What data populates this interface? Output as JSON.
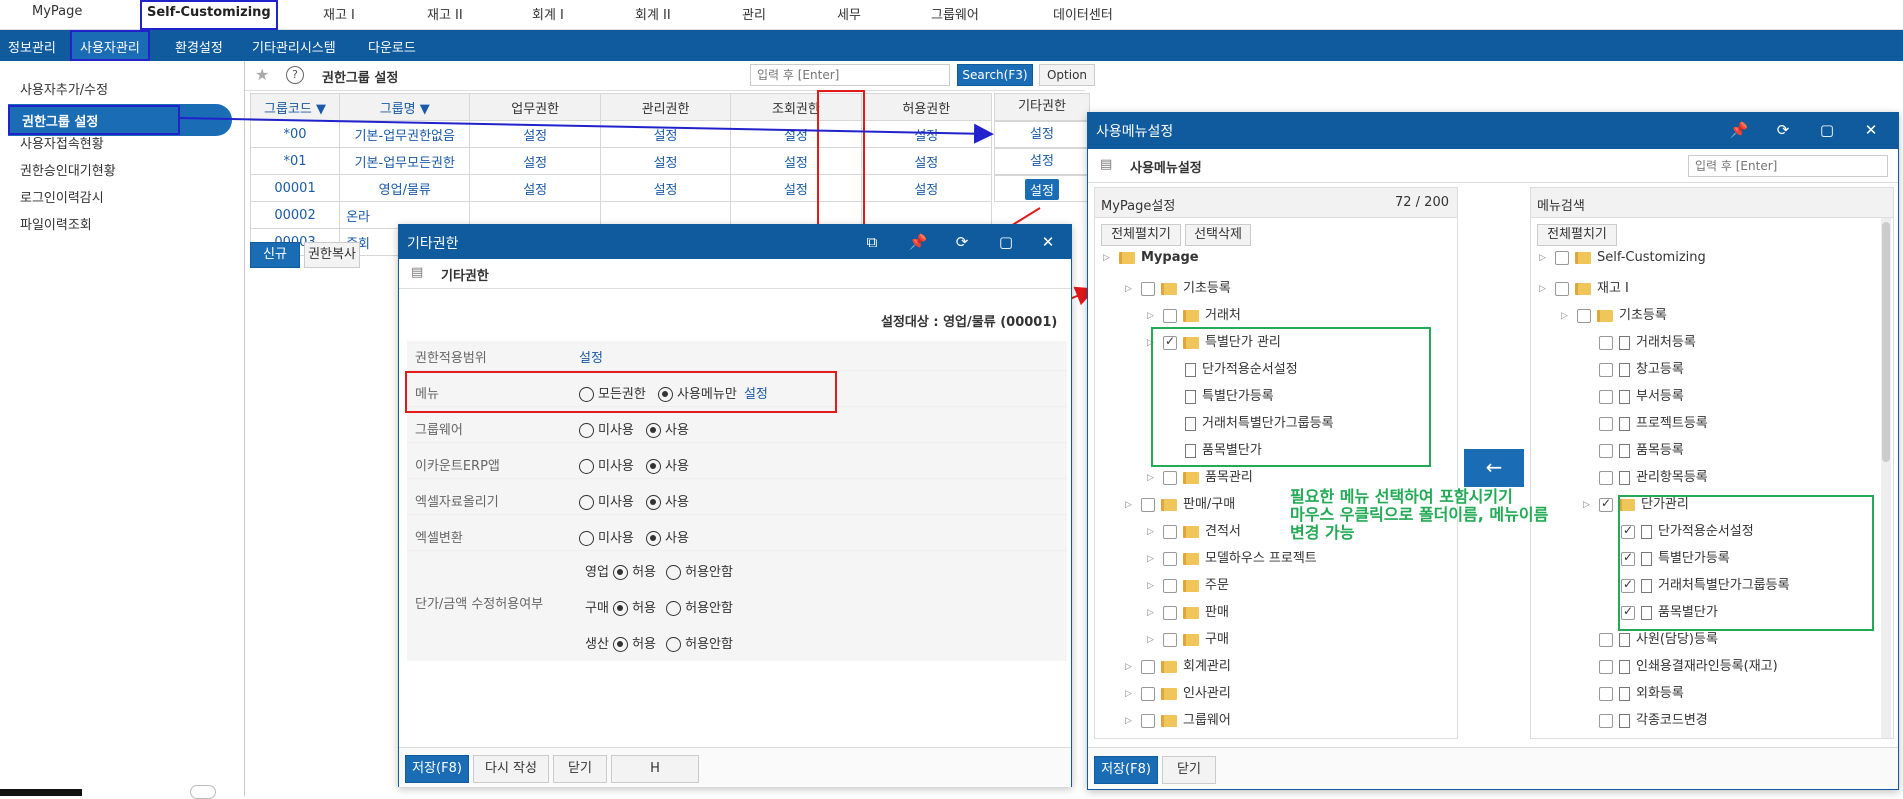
{
  "top_menu": [
    "MyPage",
    "Self-Customizing",
    "재고 I",
    "재고 II",
    "회계 I",
    "회계 II",
    "관리",
    "세무",
    "그룹웨어",
    "데이터센터"
  ],
  "sub_nav": [
    "정보관리",
    "사용자관리",
    "환경설정",
    "기타관리시스템",
    "다운로드"
  ],
  "sidebar": [
    "사용자추가/수정",
    "권한그룹 설정",
    "사용자접속현황",
    "권한승인대기현황",
    "로그인이력감시",
    "파일이력조회"
  ],
  "page": {
    "title": "권한그룹 설정",
    "search_placeholder": "입력 후 [Enter]",
    "search_btn": "Search(F3)",
    "option_btn": "Option",
    "new_btn": "신규(F2)",
    "copy_btn": "권한복사"
  },
  "grid": {
    "headers": [
      "그룹코드 ▼",
      "그룹명 ▼",
      "업무권한",
      "관리권한",
      "조회권한",
      "허용권한",
      "기타권한"
    ],
    "rows": [
      {
        "code": "*00",
        "name": "기본-업무권한없음",
        "cells": [
          "설정",
          "설정",
          "설정",
          "설정",
          "설정"
        ]
      },
      {
        "code": "*01",
        "name": "기본-업무모든권한",
        "cells": [
          "설정",
          "설정",
          "설정",
          "설정",
          "설정"
        ]
      },
      {
        "code": "00001",
        "name": "영업/물류",
        "cells": [
          "설정",
          "설정",
          "설정",
          "설정",
          "설정"
        ]
      },
      {
        "code": "00002",
        "name": "온라",
        "cells": []
      },
      {
        "code": "00003",
        "name": "중회",
        "cells": []
      }
    ]
  },
  "dlg1": {
    "title": "기타권한",
    "subtitle": "기타권한",
    "target": "설정대상 : 영업/물류 (00001)",
    "rows": [
      {
        "label": "권한적용범위",
        "value": "설정"
      },
      {
        "label": "메뉴",
        "opt1": "모든권한",
        "opt2": "사용메뉴만",
        "link": "설정"
      },
      {
        "label": "그룹웨어",
        "opt1": "미사용",
        "opt2": "사용"
      },
      {
        "label": "이카운트ERP앱",
        "opt1": "미사용",
        "opt2": "사용"
      },
      {
        "label": "엑셀자료올리기",
        "opt1": "미사용",
        "opt2": "사용"
      },
      {
        "label": "엑셀변환",
        "opt1": "미사용",
        "opt2": "사용"
      }
    ],
    "price_label": "단가/금액 수정허용여부",
    "price_rows": [
      {
        "k": "영업",
        "a": "허용",
        "b": "허용안함"
      },
      {
        "k": "구매",
        "a": "허용",
        "b": "허용안함"
      },
      {
        "k": "생산",
        "a": "허용",
        "b": "허용안함"
      }
    ],
    "buttons": [
      "저장(F8)",
      "다시 작성",
      "닫기",
      "H"
    ]
  },
  "dlg2": {
    "title": "사용메뉴설정",
    "subtitle": "사용메뉴설정",
    "search_placeholder": "입력 후 [Enter]",
    "left": {
      "title": "MyPage설정",
      "count": "72 / 200",
      "btn1": "전체펼치기",
      "btn2": "선택삭제",
      "tree": [
        {
          "t": "Mypage",
          "lvl": 0,
          "chk": "none",
          "type": "folder",
          "bold": true
        },
        {
          "t": "기초등록",
          "lvl": 1,
          "chk": "off",
          "type": "folder"
        },
        {
          "t": "거래처",
          "lvl": 2,
          "chk": "off",
          "type": "folder"
        },
        {
          "t": "특별단가 관리",
          "lvl": 2,
          "chk": "on",
          "type": "folder"
        },
        {
          "t": "단가적용순서설정",
          "lvl": 3,
          "chk": "none",
          "type": "file"
        },
        {
          "t": "특별단가등록",
          "lvl": 3,
          "chk": "none",
          "type": "file"
        },
        {
          "t": "거래처특별단가그룹등록",
          "lvl": 3,
          "chk": "none",
          "type": "file"
        },
        {
          "t": "품목별단가",
          "lvl": 3,
          "chk": "none",
          "type": "file"
        },
        {
          "t": "품목관리",
          "lvl": 2,
          "chk": "off",
          "type": "folder"
        },
        {
          "t": "판매/구매",
          "lvl": 1,
          "chk": "off",
          "type": "folder"
        },
        {
          "t": "견적서",
          "lvl": 2,
          "chk": "off",
          "type": "folder"
        },
        {
          "t": "모델하우스 프로젝트",
          "lvl": 2,
          "chk": "off",
          "type": "folder"
        },
        {
          "t": "주문",
          "lvl": 2,
          "chk": "off",
          "type": "folder"
        },
        {
          "t": "판매",
          "lvl": 2,
          "chk": "off",
          "type": "folder"
        },
        {
          "t": "구매",
          "lvl": 2,
          "chk": "off",
          "type": "folder"
        },
        {
          "t": "회계관리",
          "lvl": 1,
          "chk": "off",
          "type": "folder"
        },
        {
          "t": "인사관리",
          "lvl": 1,
          "chk": "off",
          "type": "folder"
        },
        {
          "t": "그룹웨어",
          "lvl": 1,
          "chk": "off",
          "type": "folder"
        }
      ]
    },
    "right": {
      "title": "메뉴검색",
      "btn1": "전체펼치기",
      "tree": [
        {
          "t": "Self-Customizing",
          "lvl": 0,
          "chk": "off",
          "type": "folder"
        },
        {
          "t": "재고 I",
          "lvl": 0,
          "chk": "off",
          "type": "folder"
        },
        {
          "t": "기초등록",
          "lvl": 1,
          "chk": "off",
          "type": "folder"
        },
        {
          "t": "거래처등록",
          "lvl": 2,
          "chk": "off",
          "type": "file"
        },
        {
          "t": "창고등록",
          "lvl": 2,
          "chk": "off",
          "type": "file"
        },
        {
          "t": "부서등록",
          "lvl": 2,
          "chk": "off",
          "type": "file"
        },
        {
          "t": "프로젝트등록",
          "lvl": 2,
          "chk": "off",
          "type": "file"
        },
        {
          "t": "품목등록",
          "lvl": 2,
          "chk": "off",
          "type": "file"
        },
        {
          "t": "관리항목등록",
          "lvl": 2,
          "chk": "off",
          "type": "file"
        },
        {
          "t": "단가관리",
          "lvl": 2,
          "chk": "on",
          "type": "folder"
        },
        {
          "t": "단가적용순서설정",
          "lvl": 3,
          "chk": "on",
          "type": "file"
        },
        {
          "t": "특별단가등록",
          "lvl": 3,
          "chk": "on",
          "type": "file"
        },
        {
          "t": "거래처특별단가그룹등록",
          "lvl": 3,
          "chk": "on",
          "type": "file"
        },
        {
          "t": "품목별단가",
          "lvl": 3,
          "chk": "on",
          "type": "file"
        },
        {
          "t": "사원(담당)등록",
          "lvl": 2,
          "chk": "off",
          "type": "file"
        },
        {
          "t": "인쇄용결재라인등록(재고)",
          "lvl": 2,
          "chk": "off",
          "type": "file"
        },
        {
          "t": "외화등록",
          "lvl": 2,
          "chk": "off",
          "type": "file"
        },
        {
          "t": "각종코드변경",
          "lvl": 2,
          "chk": "off",
          "type": "file"
        }
      ]
    },
    "buttons": [
      "저장(F8)",
      "닫기"
    ]
  },
  "annotation": {
    "line1": "필요한 메뉴 선택하여 포함시키기",
    "line2": "마우스 우클릭으로 폴더이름, 메뉴이름",
    "line3": "변경 가능"
  }
}
